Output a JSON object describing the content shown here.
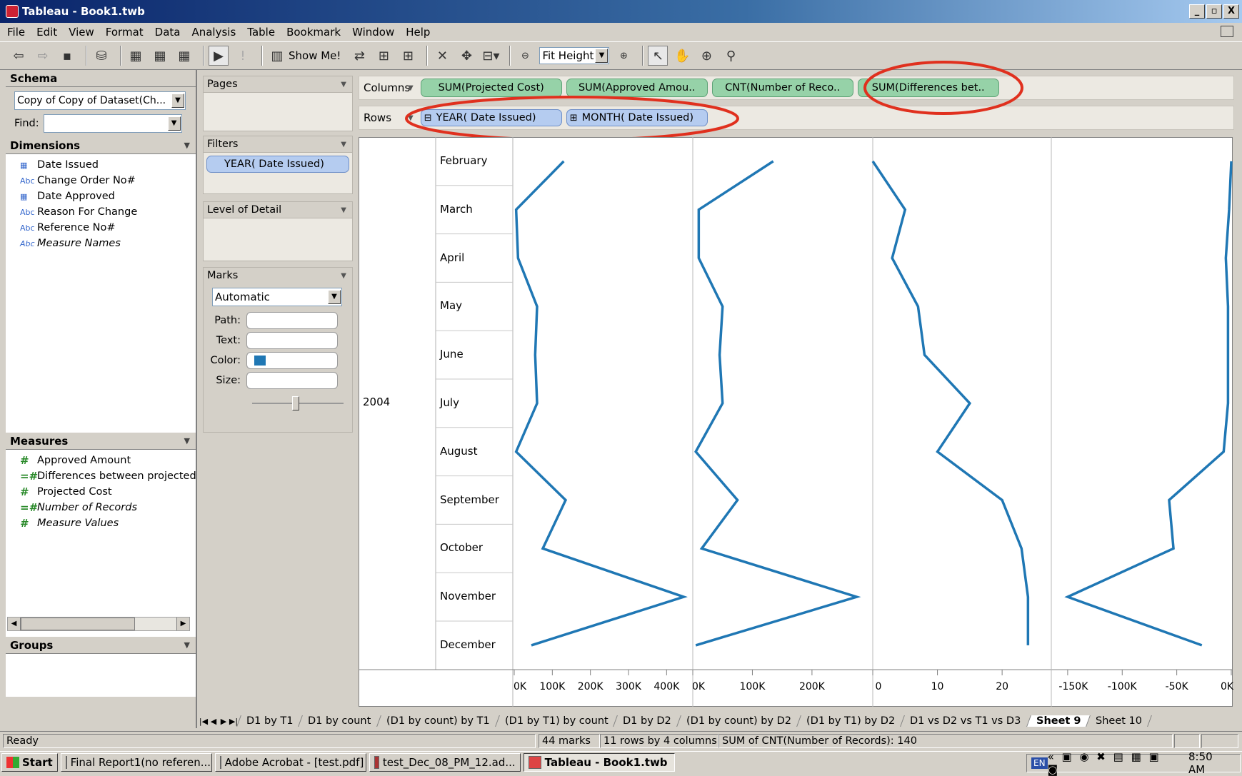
{
  "window": {
    "title": "Tableau - Book1.twb",
    "buttons": [
      "_",
      "▫",
      "X"
    ]
  },
  "menu": [
    "File",
    "Edit",
    "View",
    "Format",
    "Data",
    "Analysis",
    "Table",
    "Bookmark",
    "Window",
    "Help"
  ],
  "toolbar": {
    "show_me": "Show Me!",
    "fit": "Fit Height"
  },
  "schema": {
    "title": "Schema",
    "datasource": "Copy of Copy of Dataset(Ch...",
    "find_label": "Find:",
    "find_value": "",
    "dimensions_title": "Dimensions",
    "dimensions": [
      {
        "icon": "date-icon",
        "label": "Date  Issued",
        "italic": false
      },
      {
        "icon": "abc-icon",
        "label": "Change Order No#",
        "italic": false
      },
      {
        "icon": "date-icon",
        "label": "Date Approved",
        "italic": false
      },
      {
        "icon": "abc-icon",
        "label": "Reason For Change",
        "italic": false
      },
      {
        "icon": "abc-icon",
        "label": "Reference No#",
        "italic": false
      },
      {
        "icon": "abc-icon",
        "label": "Measure Names",
        "italic": true
      }
    ],
    "measures_title": "Measures",
    "measures": [
      {
        "icon": "#",
        "label": "Approved Amount",
        "italic": false
      },
      {
        "icon": "=#",
        "label": "Differences between projected an",
        "italic": false
      },
      {
        "icon": "#",
        "label": "Projected Cost",
        "italic": false
      },
      {
        "icon": "=#",
        "label": "Number of Records",
        "italic": true
      },
      {
        "icon": "#",
        "label": "Measure Values",
        "italic": true
      }
    ],
    "groups_title": "Groups"
  },
  "shelves": {
    "pages": "Pages",
    "filters": "Filters",
    "filter_pill": "YEAR( Date  Issued)",
    "lod": "Level of Detail",
    "marks": "Marks",
    "mark_type": "Automatic",
    "mark_labels": [
      "Path:",
      "Text:",
      "Color:",
      "Size:"
    ],
    "mark_color": "#1f77b4",
    "columns_label": "Columns",
    "rows_label": "Rows",
    "columns": [
      "SUM(Projected Cost)",
      "SUM(Approved Amou..",
      "CNT(Number of Reco..",
      "SUM(Differences bet.."
    ],
    "rows": [
      "YEAR( Date  Issued)",
      "MONTH( Date  Issued)"
    ],
    "rows_prefix": [
      "⊟",
      "⊞"
    ]
  },
  "chart_data": {
    "type": "line",
    "orientation": "vertical",
    "year": "2004",
    "categories": [
      "February",
      "March",
      "April",
      "May",
      "June",
      "July",
      "August",
      "September",
      "October",
      "November",
      "December"
    ],
    "line_color": "#1f77b4",
    "series": [
      {
        "values": [
          130000,
          5000,
          10000,
          60000,
          55000,
          60000,
          5000,
          135000,
          75000,
          445000,
          45000
        ],
        "ticks": [
          "0K",
          "100K",
          "200K",
          "300K",
          "400K"
        ],
        "domain": [
          0,
          450000
        ]
      },
      {
        "values": [
          135000,
          10000,
          10000,
          50000,
          45000,
          50000,
          5000,
          75000,
          15000,
          275000,
          5000
        ],
        "ticks": [
          "0K",
          "100K",
          "200K"
        ],
        "domain": [
          0,
          290000
        ]
      },
      {
        "values": [
          0,
          5,
          3,
          7,
          8,
          15,
          10,
          20,
          23,
          24,
          24
        ],
        "ticks": [
          "0",
          "10",
          "20"
        ],
        "domain": [
          0,
          26.5
        ]
      },
      {
        "values": [
          0,
          -2,
          -5,
          -3,
          -3,
          -3,
          -7,
          -57,
          -53,
          -150,
          -27
        ],
        "ticks": [
          "-150K",
          "-100K",
          "-50K",
          "0K"
        ],
        "domain": [
          -165,
          0
        ],
        "units_note": "thousands"
      }
    ]
  },
  "sheet_tabs": [
    "D1 by T1",
    "D1 by count",
    "(D1 by count) by T1",
    "(D1 by T1) by count",
    "D1 by D2",
    "(D1 by count) by  D2",
    "(D1 by T1) by D2",
    "D1 vs D2 vs T1 vs D3",
    "Sheet 9",
    "Sheet 10"
  ],
  "active_tab": "Sheet 9",
  "status": {
    "ready": "Ready",
    "marks": "44 marks",
    "dims": "11 rows by 4 columns",
    "summary": "SUM of CNT(Number of Records): 140"
  },
  "taskbar": {
    "start": "Start",
    "tasks": [
      "Final Report1(no referen...",
      "Adobe Acrobat - [test.pdf]",
      "test_Dec_08_PM_12.ad...",
      "Tableau - Book1.twb"
    ],
    "lang": "EN",
    "time": "8:50 AM"
  }
}
